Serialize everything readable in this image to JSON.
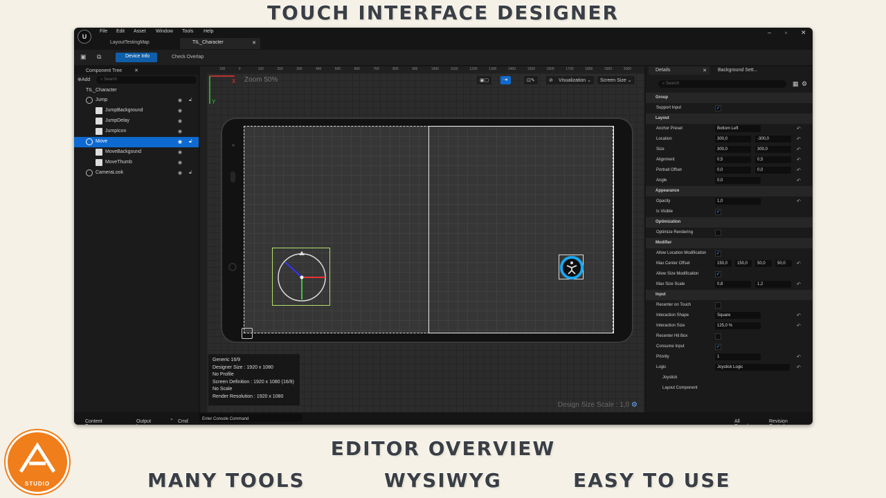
{
  "promo": {
    "title": "TOUCH INTERFACE DESIGNER",
    "subtitle": "EDITOR OVERVIEW",
    "f1": "MANY TOOLS",
    "f2": "WYSIWYG",
    "f3": "EASY TO USE",
    "logo_text": "STUDIO"
  },
  "menu": [
    "File",
    "Edit",
    "Asset",
    "Window",
    "Tools",
    "Help"
  ],
  "tabs": [
    "LayoutTestingMap",
    "TIL_Character"
  ],
  "toolbar": {
    "device_info": "Device Info",
    "check_overlap": "Check Overlap"
  },
  "tree": {
    "header": "Component Tree",
    "add": "Add",
    "search_ph": "Search",
    "root": "TIL_Character",
    "items": [
      {
        "label": "Jump"
      },
      {
        "label": "JumpBackground"
      },
      {
        "label": "JumpDelay"
      },
      {
        "label": "JumpIcon"
      },
      {
        "label": "Move"
      },
      {
        "label": "MoveBackgound"
      },
      {
        "label": "MoveThumb"
      },
      {
        "label": "CameraLook"
      }
    ]
  },
  "viewport": {
    "zoom": "Zoom 50%",
    "visualization": "Visualization",
    "screen_size": "Screen Size",
    "ruler": [
      "100",
      "0",
      "100",
      "200",
      "300",
      "400",
      "500",
      "600",
      "700",
      "800",
      "900",
      "1000",
      "1100",
      "1200",
      "1300",
      "1400",
      "1500",
      "1600",
      "1700",
      "1800",
      "1900",
      "2000"
    ],
    "info": [
      "Generic 16/9",
      "Designer Size : 1920 x 1080",
      "No Profile",
      "Screen Definition : 1920 x 1080 (16/9)",
      "No Scale",
      "Render Resolution : 1920 x 1080"
    ],
    "design_scale": "Design Size Scale : 1,0"
  },
  "details": {
    "tab1": "Details",
    "tab2": "Background Sett...",
    "search_ph": "Search",
    "rows": [
      {
        "t": "cat",
        "l": "Group"
      },
      {
        "t": "chk",
        "l": "Support Input",
        "v": "✓"
      },
      {
        "t": "cat",
        "l": "Layout"
      },
      {
        "t": "val",
        "l": "Anchor Preset",
        "v": [
          "Bottom Left"
        ]
      },
      {
        "t": "val",
        "l": "Location",
        "v": [
          "300,0",
          "-300,0"
        ]
      },
      {
        "t": "val",
        "l": "Size",
        "v": [
          "300,0",
          "300,0"
        ]
      },
      {
        "t": "val",
        "l": "Alignment",
        "v": [
          "0,5",
          "0,5"
        ]
      },
      {
        "t": "val",
        "l": "Portrait Offset",
        "v": [
          "0,0",
          "0,0"
        ]
      },
      {
        "t": "val",
        "l": "Angle",
        "v": [
          "0,0"
        ]
      },
      {
        "t": "cat",
        "l": "Appearance"
      },
      {
        "t": "val",
        "l": "Opacity",
        "v": [
          "1,0"
        ]
      },
      {
        "t": "chk",
        "l": "Is Visible",
        "v": "✓"
      },
      {
        "t": "cat",
        "l": "Optimization"
      },
      {
        "t": "chk",
        "l": "Optimize Rendering",
        "v": ""
      },
      {
        "t": "cat",
        "l": "Modifier"
      },
      {
        "t": "chk",
        "l": "Allow Location Modification",
        "v": "✓"
      },
      {
        "t": "val",
        "l": "Max Center Offset",
        "v": [
          "150,0",
          "150,0",
          "50,0",
          "50,0"
        ]
      },
      {
        "t": "chk",
        "l": "Allow Size Modification",
        "v": "✓"
      },
      {
        "t": "val",
        "l": "Max Size Scale",
        "v": [
          "0,8",
          "1,2"
        ]
      },
      {
        "t": "cat",
        "l": "Input"
      },
      {
        "t": "chk",
        "l": "Recenter on Touch",
        "v": ""
      },
      {
        "t": "val",
        "l": "Interaction Shape",
        "v": [
          "Square"
        ]
      },
      {
        "t": "val",
        "l": "Interaction Size",
        "v": [
          "125,0 %"
        ]
      },
      {
        "t": "chk",
        "l": "Recenter Hit Box",
        "v": ""
      },
      {
        "t": "chk",
        "l": "Consume Input",
        "v": "✓"
      },
      {
        "t": "val",
        "l": "Priority",
        "v": [
          "1"
        ]
      },
      {
        "t": "val",
        "l": "Logic",
        "v": [
          "Joystick Logic"
        ]
      },
      {
        "t": "sub",
        "l": "Joystick"
      },
      {
        "t": "sub",
        "l": "Layout Component"
      }
    ]
  },
  "status": {
    "content_drawer": "Content Drawer",
    "output_log": "Output Log",
    "cmd": "Cmd",
    "console_ph": "Enter Console Command",
    "saved": "All Saved",
    "revision": "Revision Control"
  }
}
